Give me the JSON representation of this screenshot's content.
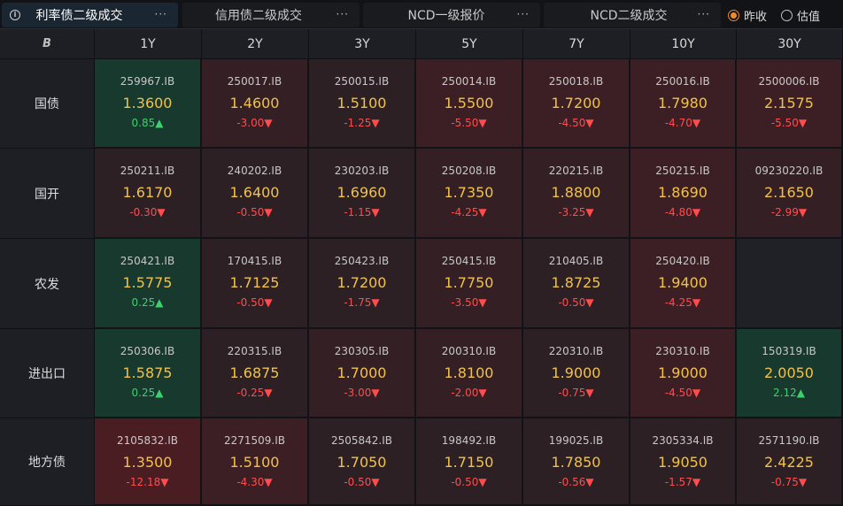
{
  "tabs": [
    {
      "label": "利率债二级成交",
      "more": "···",
      "active": true
    },
    {
      "label": "信用债二级成交",
      "more": "···",
      "active": false
    },
    {
      "label": "NCD一级报价",
      "more": "···",
      "active": false
    },
    {
      "label": "NCD二级成交",
      "more": "···",
      "active": false
    }
  ],
  "info_icon": "i",
  "radio_options": [
    {
      "label": "昨收",
      "checked": true
    },
    {
      "label": "估值",
      "checked": false
    }
  ],
  "corner_icon": "B",
  "columns": [
    "1Y",
    "2Y",
    "3Y",
    "5Y",
    "7Y",
    "10Y",
    "30Y"
  ],
  "rows": [
    {
      "label": "国债",
      "cells": [
        {
          "code": "259967.IB",
          "price": "1.3600",
          "change": "0.85",
          "dir": "up"
        },
        {
          "code": "250017.IB",
          "price": "1.4600",
          "change": "-3.00",
          "dir": "down"
        },
        {
          "code": "250015.IB",
          "price": "1.5100",
          "change": "-1.25",
          "dir": "down"
        },
        {
          "code": "250014.IB",
          "price": "1.5500",
          "change": "-5.50",
          "dir": "down"
        },
        {
          "code": "250018.IB",
          "price": "1.7200",
          "change": "-4.50",
          "dir": "down"
        },
        {
          "code": "250016.IB",
          "price": "1.7980",
          "change": "-4.70",
          "dir": "down"
        },
        {
          "code": "2500006.IB",
          "price": "2.1575",
          "change": "-5.50",
          "dir": "down"
        }
      ]
    },
    {
      "label": "国开",
      "cells": [
        {
          "code": "250211.IB",
          "price": "1.6170",
          "change": "-0.30",
          "dir": "down"
        },
        {
          "code": "240202.IB",
          "price": "1.6400",
          "change": "-0.50",
          "dir": "down"
        },
        {
          "code": "230203.IB",
          "price": "1.6960",
          "change": "-1.15",
          "dir": "down"
        },
        {
          "code": "250208.IB",
          "price": "1.7350",
          "change": "-4.25",
          "dir": "down"
        },
        {
          "code": "220215.IB",
          "price": "1.8800",
          "change": "-3.25",
          "dir": "down"
        },
        {
          "code": "250215.IB",
          "price": "1.8690",
          "change": "-4.80",
          "dir": "down"
        },
        {
          "code": "09230220.IB",
          "price": "2.1650",
          "change": "-2.99",
          "dir": "down"
        }
      ]
    },
    {
      "label": "农发",
      "cells": [
        {
          "code": "250421.IB",
          "price": "1.5775",
          "change": "0.25",
          "dir": "up"
        },
        {
          "code": "170415.IB",
          "price": "1.7125",
          "change": "-0.50",
          "dir": "down"
        },
        {
          "code": "250423.IB",
          "price": "1.7200",
          "change": "-1.75",
          "dir": "down"
        },
        {
          "code": "250415.IB",
          "price": "1.7750",
          "change": "-3.50",
          "dir": "down"
        },
        {
          "code": "210405.IB",
          "price": "1.8725",
          "change": "-0.50",
          "dir": "down"
        },
        {
          "code": "250420.IB",
          "price": "1.9400",
          "change": "-4.25",
          "dir": "down"
        },
        null
      ]
    },
    {
      "label": "进出口",
      "cells": [
        {
          "code": "250306.IB",
          "price": "1.5875",
          "change": "0.25",
          "dir": "up"
        },
        {
          "code": "220315.IB",
          "price": "1.6875",
          "change": "-0.25",
          "dir": "down"
        },
        {
          "code": "230305.IB",
          "price": "1.7000",
          "change": "-3.00",
          "dir": "down"
        },
        {
          "code": "200310.IB",
          "price": "1.8100",
          "change": "-2.00",
          "dir": "down"
        },
        {
          "code": "220310.IB",
          "price": "1.9000",
          "change": "-0.75",
          "dir": "down"
        },
        {
          "code": "230310.IB",
          "price": "1.9000",
          "change": "-4.50",
          "dir": "down"
        },
        {
          "code": "150319.IB",
          "price": "2.0050",
          "change": "2.12",
          "dir": "up"
        }
      ]
    },
    {
      "label": "地方债",
      "cells": [
        {
          "code": "2105832.IB",
          "price": "1.3500",
          "change": "-12.18",
          "dir": "down"
        },
        {
          "code": "2271509.IB",
          "price": "1.5100",
          "change": "-4.30",
          "dir": "down"
        },
        {
          "code": "2505842.IB",
          "price": "1.7050",
          "change": "-0.50",
          "dir": "down"
        },
        {
          "code": "198492.IB",
          "price": "1.7150",
          "change": "-0.50",
          "dir": "down"
        },
        {
          "code": "199025.IB",
          "price": "1.7850",
          "change": "-0.56",
          "dir": "down"
        },
        {
          "code": "2305334.IB",
          "price": "1.9050",
          "change": "-1.57",
          "dir": "down"
        },
        {
          "code": "2571190.IB",
          "price": "2.4225",
          "change": "-0.75",
          "dir": "down"
        }
      ]
    }
  ],
  "colors": {
    "price": "#f0c24a",
    "down": "#ff4d4d",
    "up": "#3ed06c",
    "radio_accent": "#f08a2a"
  }
}
